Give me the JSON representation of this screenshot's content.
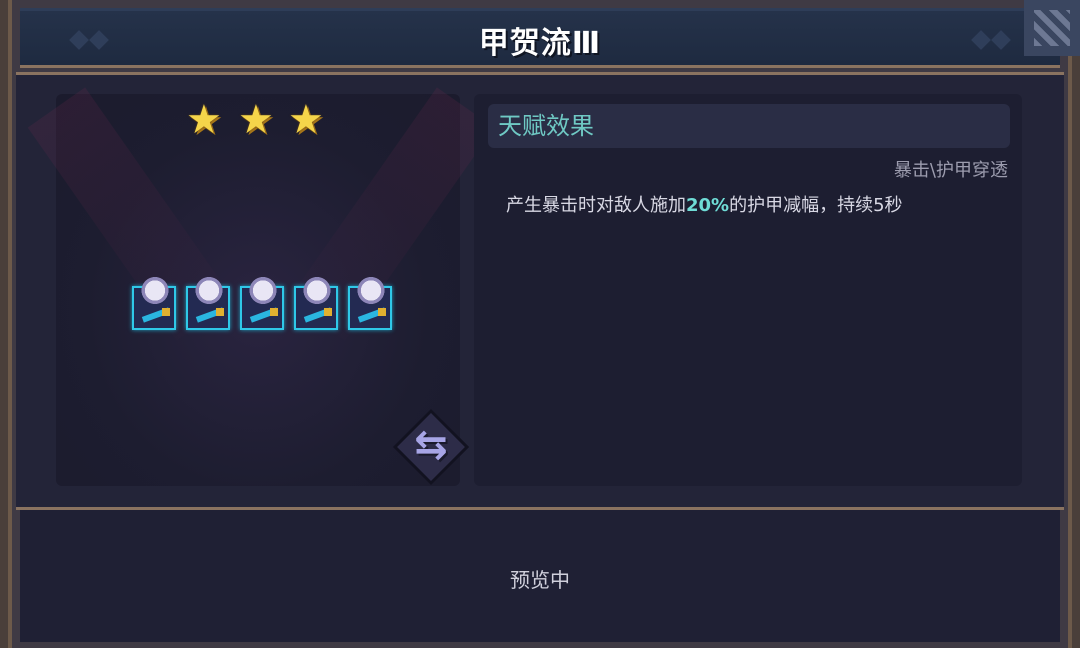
{
  "header": {
    "title": "甲贺流Ⅲ"
  },
  "stage": {
    "star_count": 3,
    "unit_count": 5,
    "star_glyph": "★",
    "swap_glyph": "⇆"
  },
  "talent": {
    "section_title": "天赋效果",
    "tags": "暴击\\护甲穿透",
    "desc_prefix": "产生暴击时对敌人施加",
    "desc_highlight": "20%",
    "desc_suffix": "的护甲减幅，持续5秒"
  },
  "footer": {
    "status": "预览中"
  },
  "colors": {
    "highlight": "#6fdcd6",
    "section_title": "#6fc9c4",
    "unit_border": "#2fc8e8",
    "star": "#f5d54a"
  },
  "icons": {
    "star": "star-icon",
    "swap": "swap-icon",
    "corner": "close-corner-icon"
  }
}
